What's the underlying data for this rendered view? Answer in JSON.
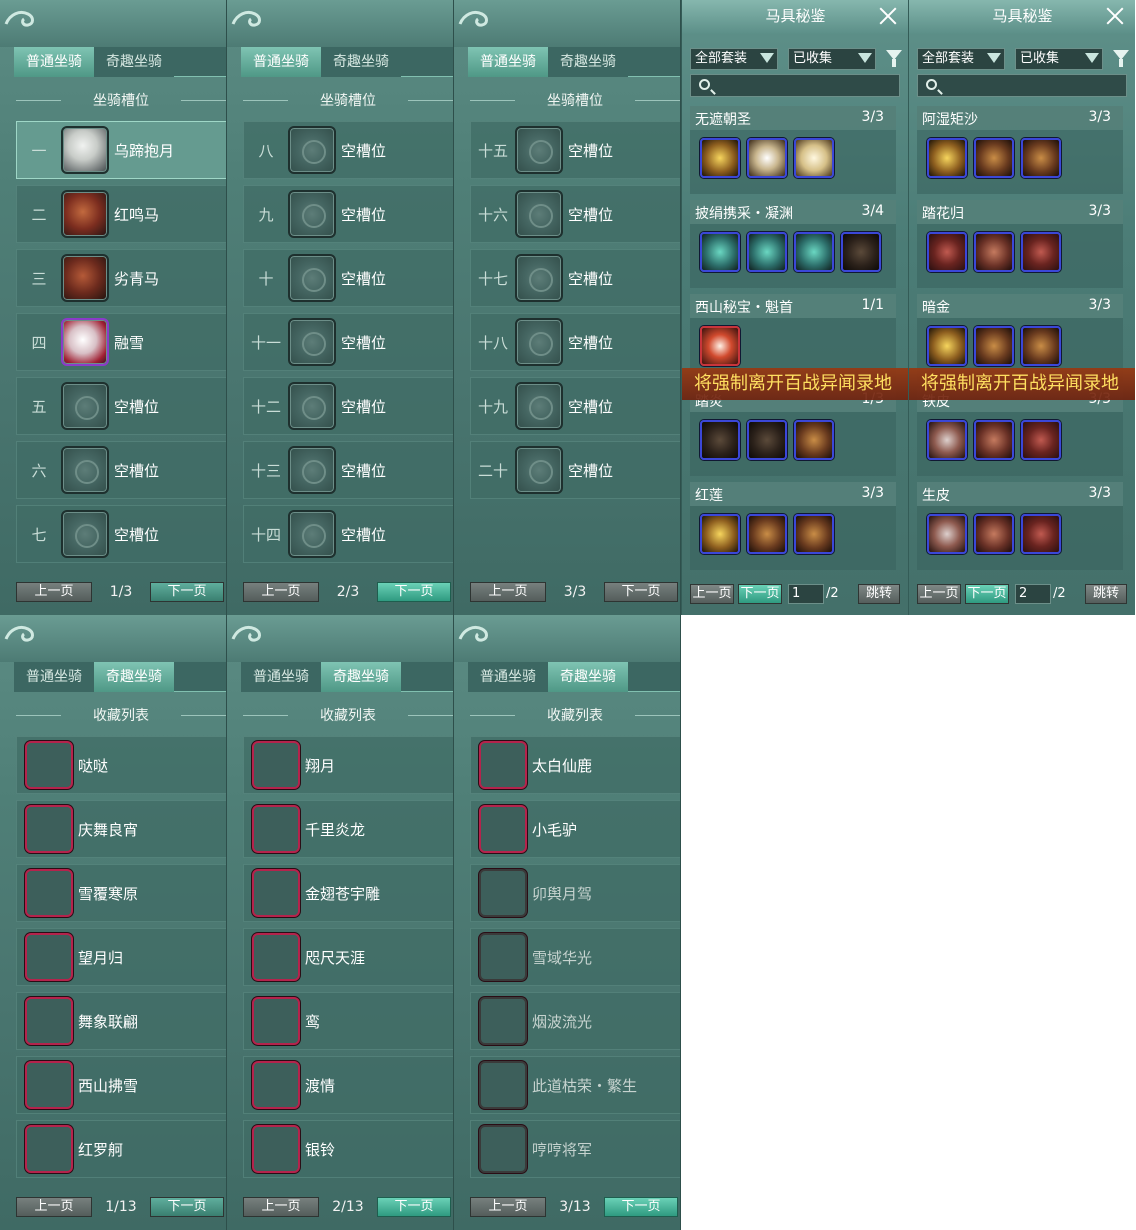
{
  "mount_panels": [
    {
      "tabs": [
        "普通坐骑",
        "奇趣坐骑"
      ],
      "active_tab": 0,
      "header": "坐骑槽位",
      "rows": [
        {
          "num": "一",
          "label": "乌蹄抱月",
          "icon": "m1"
        },
        {
          "num": "二",
          "label": "红鸣马",
          "icon": "m2"
        },
        {
          "num": "三",
          "label": "劣青马",
          "icon": "m3"
        },
        {
          "num": "四",
          "label": "融雪",
          "icon": "m4"
        },
        {
          "num": "五",
          "label": "空槽位",
          "icon": "empty"
        },
        {
          "num": "六",
          "label": "空槽位",
          "icon": "empty"
        },
        {
          "num": "七",
          "label": "空槽位",
          "icon": "empty"
        }
      ],
      "prev": "上一页",
      "page": "1/3",
      "next": "下一页"
    },
    {
      "tabs": [
        "普通坐骑",
        "奇趣坐骑"
      ],
      "active_tab": 0,
      "header": "坐骑槽位",
      "rows": [
        {
          "num": "八",
          "label": "空槽位",
          "icon": "empty"
        },
        {
          "num": "九",
          "label": "空槽位",
          "icon": "empty"
        },
        {
          "num": "十",
          "label": "空槽位",
          "icon": "empty"
        },
        {
          "num": "十一",
          "label": "空槽位",
          "icon": "empty"
        },
        {
          "num": "十二",
          "label": "空槽位",
          "icon": "empty"
        },
        {
          "num": "十三",
          "label": "空槽位",
          "icon": "empty"
        },
        {
          "num": "十四",
          "label": "空槽位",
          "icon": "empty"
        }
      ],
      "prev": "上一页",
      "page": "2/3",
      "next": "下一页"
    },
    {
      "tabs": [
        "普通坐骑",
        "奇趣坐骑"
      ],
      "active_tab": 0,
      "header": "坐骑槽位",
      "rows": [
        {
          "num": "十五",
          "label": "空槽位",
          "icon": "empty"
        },
        {
          "num": "十六",
          "label": "空槽位",
          "icon": "empty"
        },
        {
          "num": "十七",
          "label": "空槽位",
          "icon": "empty"
        },
        {
          "num": "十八",
          "label": "空槽位",
          "icon": "empty"
        },
        {
          "num": "十九",
          "label": "空槽位",
          "icon": "empty"
        },
        {
          "num": "二十",
          "label": "空槽位",
          "icon": "empty"
        }
      ],
      "prev": "上一页",
      "page": "3/3",
      "next": "下一页"
    },
    {
      "tabs": [
        "普通坐骑",
        "奇趣坐骑"
      ],
      "active_tab": 1,
      "header": "收藏列表",
      "rows": [
        {
          "label": "哒哒",
          "icon": "ci1"
        },
        {
          "label": "庆舞良宵",
          "icon": "ci2"
        },
        {
          "label": "雪覆寒原",
          "icon": "ci3"
        },
        {
          "label": "望月归",
          "icon": "ci4"
        },
        {
          "label": "舞象联翩",
          "icon": "ci5"
        },
        {
          "label": "西山拂雪",
          "icon": "ci6"
        },
        {
          "label": "红罗舸",
          "icon": "ci7"
        }
      ],
      "prev": "上一页",
      "page": "1/13",
      "next": "下一页"
    },
    {
      "tabs": [
        "普通坐骑",
        "奇趣坐骑"
      ],
      "active_tab": 1,
      "header": "收藏列表",
      "rows": [
        {
          "label": "翔月",
          "icon": "ci8"
        },
        {
          "label": "千里炎龙",
          "icon": "ci9"
        },
        {
          "label": "金翅苍宇雕",
          "icon": "ci10"
        },
        {
          "label": "咫尺天涯",
          "icon": "ci11"
        },
        {
          "label": "鸾",
          "icon": "ci12"
        },
        {
          "label": "渡情",
          "icon": "ci13"
        },
        {
          "label": "银铃",
          "icon": "ci14"
        }
      ],
      "prev": "上一页",
      "page": "2/13",
      "next": "下一页"
    },
    {
      "tabs": [
        "普通坐骑",
        "奇趣坐骑"
      ],
      "active_tab": 1,
      "header": "收藏列表",
      "rows": [
        {
          "label": "太白仙鹿",
          "icon": "ci15"
        },
        {
          "label": "小毛驴",
          "icon": "ci16"
        },
        {
          "label": "卯舆月驾",
          "icon": "ci17",
          "gray": true
        },
        {
          "label": "雪域华光",
          "icon": "ci18",
          "gray": true
        },
        {
          "label": "烟波流光",
          "icon": "ci19",
          "gray": true
        },
        {
          "label": "此道枯荣・繁生",
          "icon": "ci20",
          "gray": true
        },
        {
          "label": "哼哼将军",
          "icon": "ci21",
          "gray": true
        }
      ],
      "prev": "上一页",
      "page": "3/13",
      "next": "下一页"
    }
  ],
  "gear_panels": [
    {
      "title": "马具秘鉴",
      "filter1": "全部套装",
      "filter2": "已收集",
      "sets": [
        {
          "name": "无遮朝圣",
          "count": "3/3",
          "gear": [
            "g-gold",
            "g-silver",
            "g-white"
          ]
        },
        {
          "name": "披绢携采・凝渊",
          "count": "3/4",
          "gear": [
            "g-teal",
            "g-teal",
            "g-teal",
            "g-dark"
          ]
        },
        {
          "name": "西山秘宝・魁首",
          "count": "1/1",
          "gear": [
            "g-red"
          ]
        },
        {
          "name": "踏炎",
          "count": "1/3",
          "gear": [
            "g-dark",
            "g-dark",
            "g-brown"
          ]
        },
        {
          "name": "红莲",
          "count": "3/3",
          "gear": [
            "g-gold",
            "g-brown",
            "g-brown"
          ]
        }
      ],
      "banner": "将强制离开百战异闻录地",
      "prev": "上一页",
      "next": "下一页",
      "page_input": "1",
      "page_total": "/2",
      "jump": "跳转"
    },
    {
      "title": "马具秘鉴",
      "filter1": "全部套装",
      "filter2": "已收集",
      "sets": [
        {
          "name": "阿湿矩沙",
          "count": "3/3",
          "gear": [
            "g-gold",
            "g-brown",
            "g-brown"
          ]
        },
        {
          "name": "踏花归",
          "count": "3/3",
          "gear": [
            "g-teal2",
            "g-saddle",
            "g-teal2"
          ]
        },
        {
          "name": "暗金",
          "count": "3/3",
          "gear": [
            "g-gold",
            "g-brown",
            "g-brown"
          ]
        },
        {
          "name": "铁皮",
          "count": "3/3",
          "gear": [
            "g-rose",
            "g-saddle",
            "g-teal2"
          ]
        },
        {
          "name": "生皮",
          "count": "3/3",
          "gear": [
            "g-rose",
            "g-saddle",
            "g-teal2"
          ]
        }
      ],
      "banner": "将强制离开百战异闻录地",
      "prev": "上一页",
      "next": "下一页",
      "page_input": "2",
      "page_total": "/2",
      "jump": "跳转"
    }
  ]
}
